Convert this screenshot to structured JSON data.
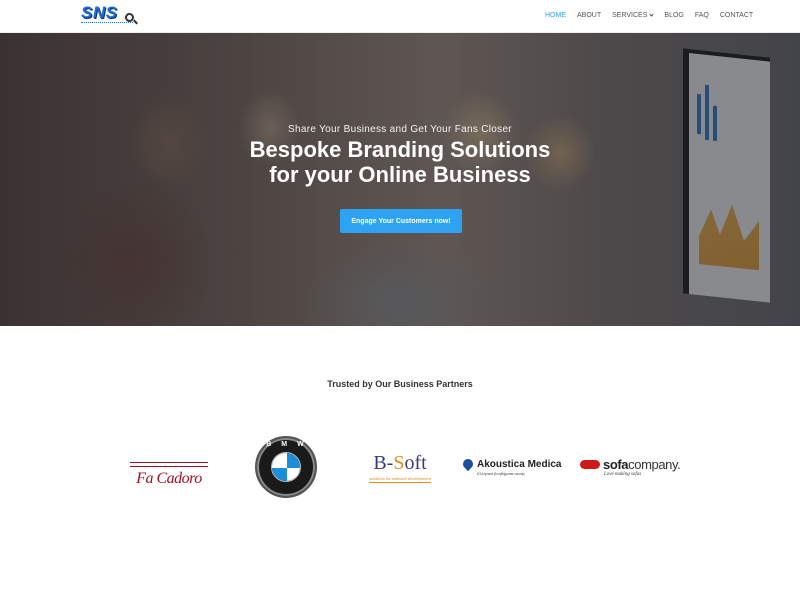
{
  "logo": {
    "text": "SNS",
    "tagline": "social network solutions"
  },
  "nav": {
    "items": [
      {
        "label": "HOME",
        "active": true
      },
      {
        "label": "ABOUT",
        "active": false
      },
      {
        "label": "SERVICES",
        "active": false,
        "has_dropdown": true
      },
      {
        "label": "BLOG",
        "active": false
      },
      {
        "label": "FAQ",
        "active": false
      },
      {
        "label": "CONTACT",
        "active": false
      }
    ]
  },
  "hero": {
    "subtitle": "Share Your Business and Get Your Fans Closer",
    "title_line1": "Bespoke Branding Solutions",
    "title_line2": "for your Online Business",
    "cta_label": "Engage Your Customers now!"
  },
  "partners": {
    "heading": "Trusted by Our Business Partners",
    "logos": [
      {
        "name": "Fa Cadoro",
        "text": "Fa Cadoro"
      },
      {
        "name": "BMW",
        "text": "BMW"
      },
      {
        "name": "B-Soft",
        "text_b": "B-",
        "text_o": "S",
        "text_rest": "oft",
        "tagline": "solutions for software development"
      },
      {
        "name": "Akoustica Medica",
        "text": "Akoustica Medica",
        "tagline": "Ελληνικά βοηθήματα ακοής"
      },
      {
        "name": "sofa company",
        "text_bold": "sofa",
        "text_light": "company.",
        "tagline": "Love making sofas"
      }
    ]
  },
  "colors": {
    "accent": "#2ea3f2",
    "logo_blue": "#1e6fd0",
    "text_dark": "#333333"
  }
}
